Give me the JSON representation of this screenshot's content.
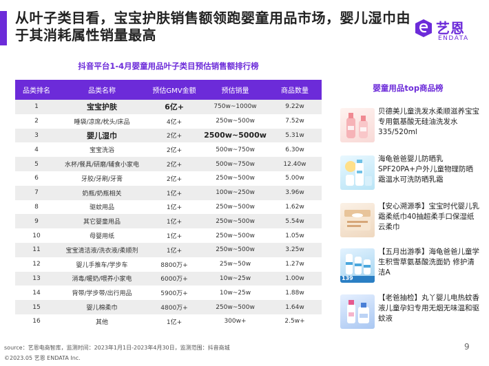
{
  "headline": "从叶子类目看，宝宝护肤销售额领跑婴童用品市场，婴儿湿巾由于其消耗属性销量最高",
  "logo": {
    "cn": "艺恩",
    "en": "ENDATA",
    "color": "#6c2bd9"
  },
  "table": {
    "title": "抖音平台1-4月婴童用品叶子类目预估销售额排行榜",
    "headers": [
      "品类排名",
      "品类名称",
      "预估GMV金额",
      "预估销量",
      "商品数量"
    ],
    "rows": [
      [
        "1",
        "宝宝护肤",
        "6亿+",
        "750w~1000w",
        "9.22w"
      ],
      [
        "2",
        "睡袋/凉席/枕头/床品",
        "4亿+",
        "250w~500w",
        "7.52w"
      ],
      [
        "3",
        "婴儿湿巾",
        "2亿+",
        "2500w~5000w",
        "5.31w"
      ],
      [
        "4",
        "宝宝洗浴",
        "2亿+",
        "500w~750w",
        "6.30w"
      ],
      [
        "5",
        "水杯/餐具/研磨/辅食小家电",
        "2亿+",
        "500w~750w",
        "12.40w"
      ],
      [
        "6",
        "牙胶/牙刷/牙膏",
        "2亿+",
        "250w~500w",
        "5.00w"
      ],
      [
        "7",
        "奶瓶/奶瓶相关",
        "1亿+",
        "100w~250w",
        "3.96w"
      ],
      [
        "8",
        "驱蚊用品",
        "1亿+",
        "250w~500w",
        "1.62w"
      ],
      [
        "9",
        "其它婴童用品",
        "1亿+",
        "250w~500w",
        "5.54w"
      ],
      [
        "10",
        "母婴用纸",
        "1亿+",
        "250w~500w",
        "1.05w"
      ],
      [
        "11",
        "宝宝清洁液/洗衣液/柔顺剂",
        "1亿+",
        "250w~500w",
        "3.25w"
      ],
      [
        "12",
        "婴儿手推车/学步车",
        "8800万+",
        "25w~50w",
        "1.27w"
      ],
      [
        "13",
        "消毒/暖奶/喂养小家电",
        "6000万+",
        "10w~25w",
        "1.00w"
      ],
      [
        "14",
        "背带/学步带/出行用品",
        "5900万+",
        "10w~25w",
        "1.88w"
      ],
      [
        "15",
        "婴儿棉柔巾",
        "4800万+",
        "250w~500w",
        "1.64w"
      ],
      [
        "16",
        "其他",
        "1亿+",
        "300w+",
        "2.5w+"
      ]
    ],
    "header_color": "#6c2bd9",
    "stripe_color": "#ededed"
  },
  "products": {
    "title": "婴童用品top商品榜",
    "items": [
      {
        "text": "贝德美儿童洗发水柔顺滋养宝宝专用氨基酸无硅油洗发水 335/520ml",
        "image": "shampoo-bottles-image"
      },
      {
        "text": "海龟爸爸婴儿防晒乳SPF20PA+户外儿童物理防晒霜温水可洗防晒乳霜",
        "image": "sunscreen-image"
      },
      {
        "text": "【安心溯源季】宝宝时代婴儿乳霜柔纸巾40抽超柔手口保湿纸云柔巾",
        "image": "tissue-pack-image"
      },
      {
        "text": "【五月出游季】海龟爸爸儿童学生积雪草氨基酸洗面奶 修护清洁A",
        "image": "face-wash-image",
        "badge": "139"
      },
      {
        "text": "【老爸抽检】丸丫婴儿电热蚊香液儿童孕妇专用无烟无味温和驱蚊液",
        "image": "mosquito-liquid-image"
      }
    ]
  },
  "footer": {
    "source": "source：艺恩电商智库，监测时间：2023年1月1日-2023年4月30日，监测范围：抖音商城",
    "copyright": "©2023.05 艺恩 ENDATA Inc.",
    "page": "9"
  }
}
